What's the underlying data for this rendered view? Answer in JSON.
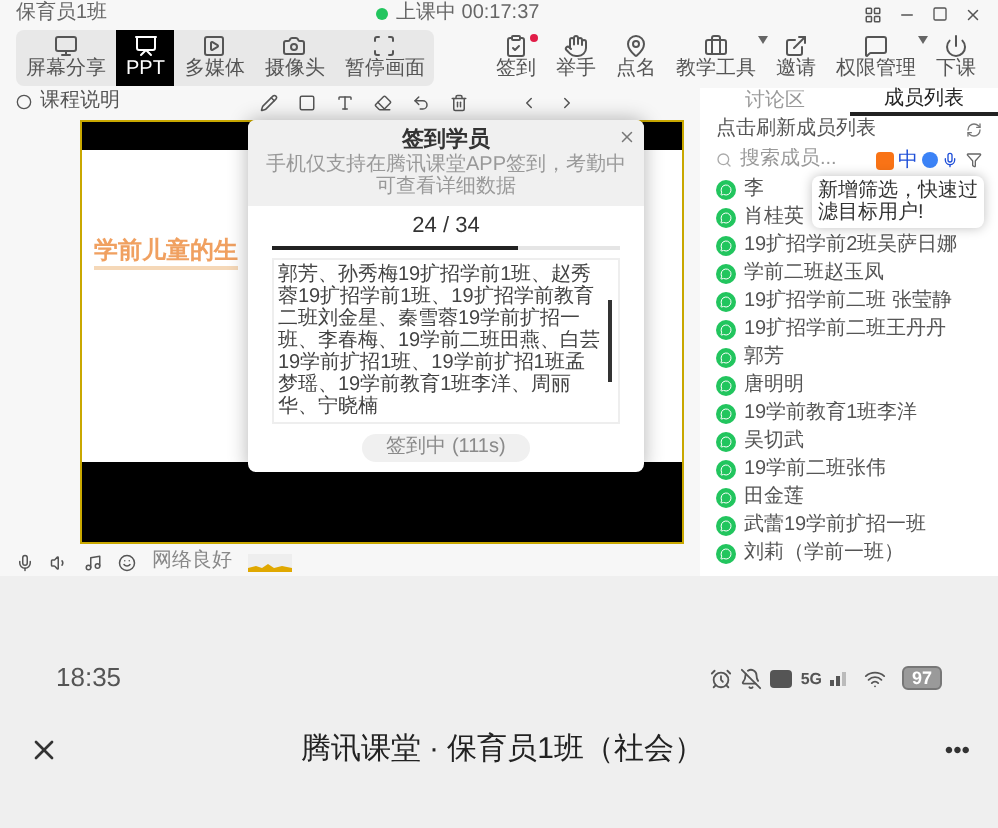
{
  "app": {
    "class_name": "保育员1班",
    "session_status": "上课中 00:17:37",
    "modes": [
      {
        "label": "屏幕分享",
        "selected": false
      },
      {
        "label": "PPT",
        "selected": true
      },
      {
        "label": "多媒体",
        "selected": false
      },
      {
        "label": "摄像头",
        "selected": false
      },
      {
        "label": "暂停画面",
        "selected": false
      }
    ],
    "tools": [
      {
        "label": "签到",
        "badge": true,
        "dropdown": false
      },
      {
        "label": "举手",
        "badge": false,
        "dropdown": false
      },
      {
        "label": "点名",
        "badge": false,
        "dropdown": false
      },
      {
        "label": "教学工具",
        "badge": false,
        "dropdown": true
      },
      {
        "label": "邀请",
        "badge": false,
        "dropdown": false
      },
      {
        "label": "权限管理",
        "badge": false,
        "dropdown": true
      },
      {
        "label": "下课",
        "badge": false,
        "dropdown": false
      }
    ],
    "note": "课程说明",
    "slide": {
      "title": "学前儿童的生"
    },
    "modal": {
      "title": "签到学员",
      "subtitle": "手机仅支持在腾讯课堂APP签到，考勤中可查看详细数据",
      "count": "24 / 34",
      "level": 0.706,
      "names": "郭芳、孙秀梅19扩招学前1班、赵秀蓉19扩招学前1班、19扩招学前教育二班刘金星、秦雪蓉19学前扩招一班、李春梅、19学前二班田燕、白芸19学前扩招1班、19学前扩招1班孟梦瑶、19学前教育1班李洋、周丽华、宁晓楠",
      "button": {
        "label": "签到中 (111s)",
        "disabled": true
      }
    },
    "panel": {
      "tabs": [
        {
          "label": "讨论区",
          "selected": false
        },
        {
          "label": "成员列表",
          "selected": true
        }
      ],
      "refresh_label": "点击刷新成员列表",
      "search_placeholder": "搜索成员...",
      "tooltip": "新增筛选，快速过滤目标用户!",
      "members": [
        "李",
        "肖桂英",
        "19扩招学前2班吴萨日娜",
        "学前二班赵玉凤",
        "19扩招学前二班 张莹静",
        "19扩招学前二班王丹丹",
        "郭芳",
        "唐明明",
        "19学前教育1班李洋",
        "吴切武",
        "19学前二班张伟",
        "田金莲",
        "武蕾19学前扩招一班",
        "刘莉（学前一班）"
      ]
    },
    "ime": {
      "label": "中"
    },
    "network": "网络良好"
  },
  "phone": {
    "time": "18:35",
    "network_type": "5G",
    "battery": "97",
    "title": "腾讯课堂 · 保育员1班（社会）",
    "more": "•••"
  }
}
